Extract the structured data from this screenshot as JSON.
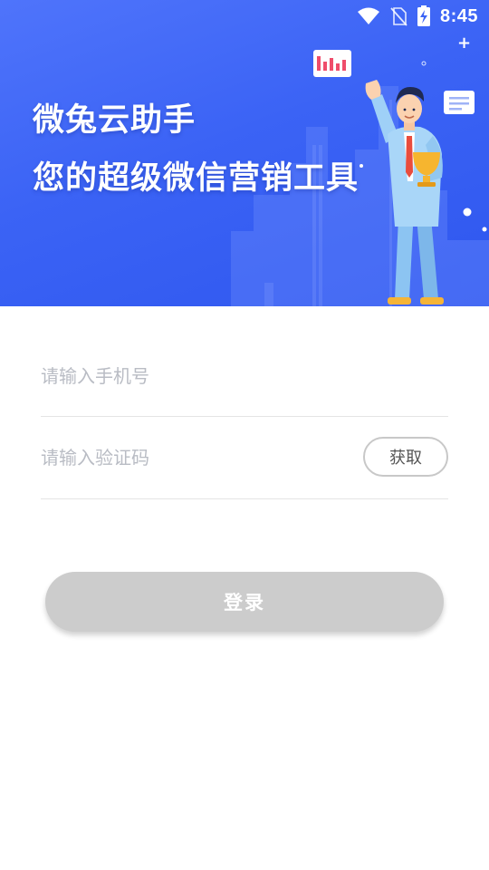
{
  "status_bar": {
    "time": "8:45",
    "icons": [
      "wifi-icon",
      "no-sim-icon",
      "battery-charging-icon"
    ]
  },
  "hero": {
    "title": "微兔云助手",
    "subtitle": "您的超级微信营销工具"
  },
  "form": {
    "phone": {
      "value": "",
      "placeholder": "请输入手机号"
    },
    "code": {
      "value": "",
      "placeholder": "请输入验证码"
    },
    "get_code_label": "获取"
  },
  "login_label": "登录",
  "colors": {
    "hero_blue": "#3b63f5",
    "disabled_button": "#cccccc",
    "placeholder": "#b9bcc4"
  }
}
